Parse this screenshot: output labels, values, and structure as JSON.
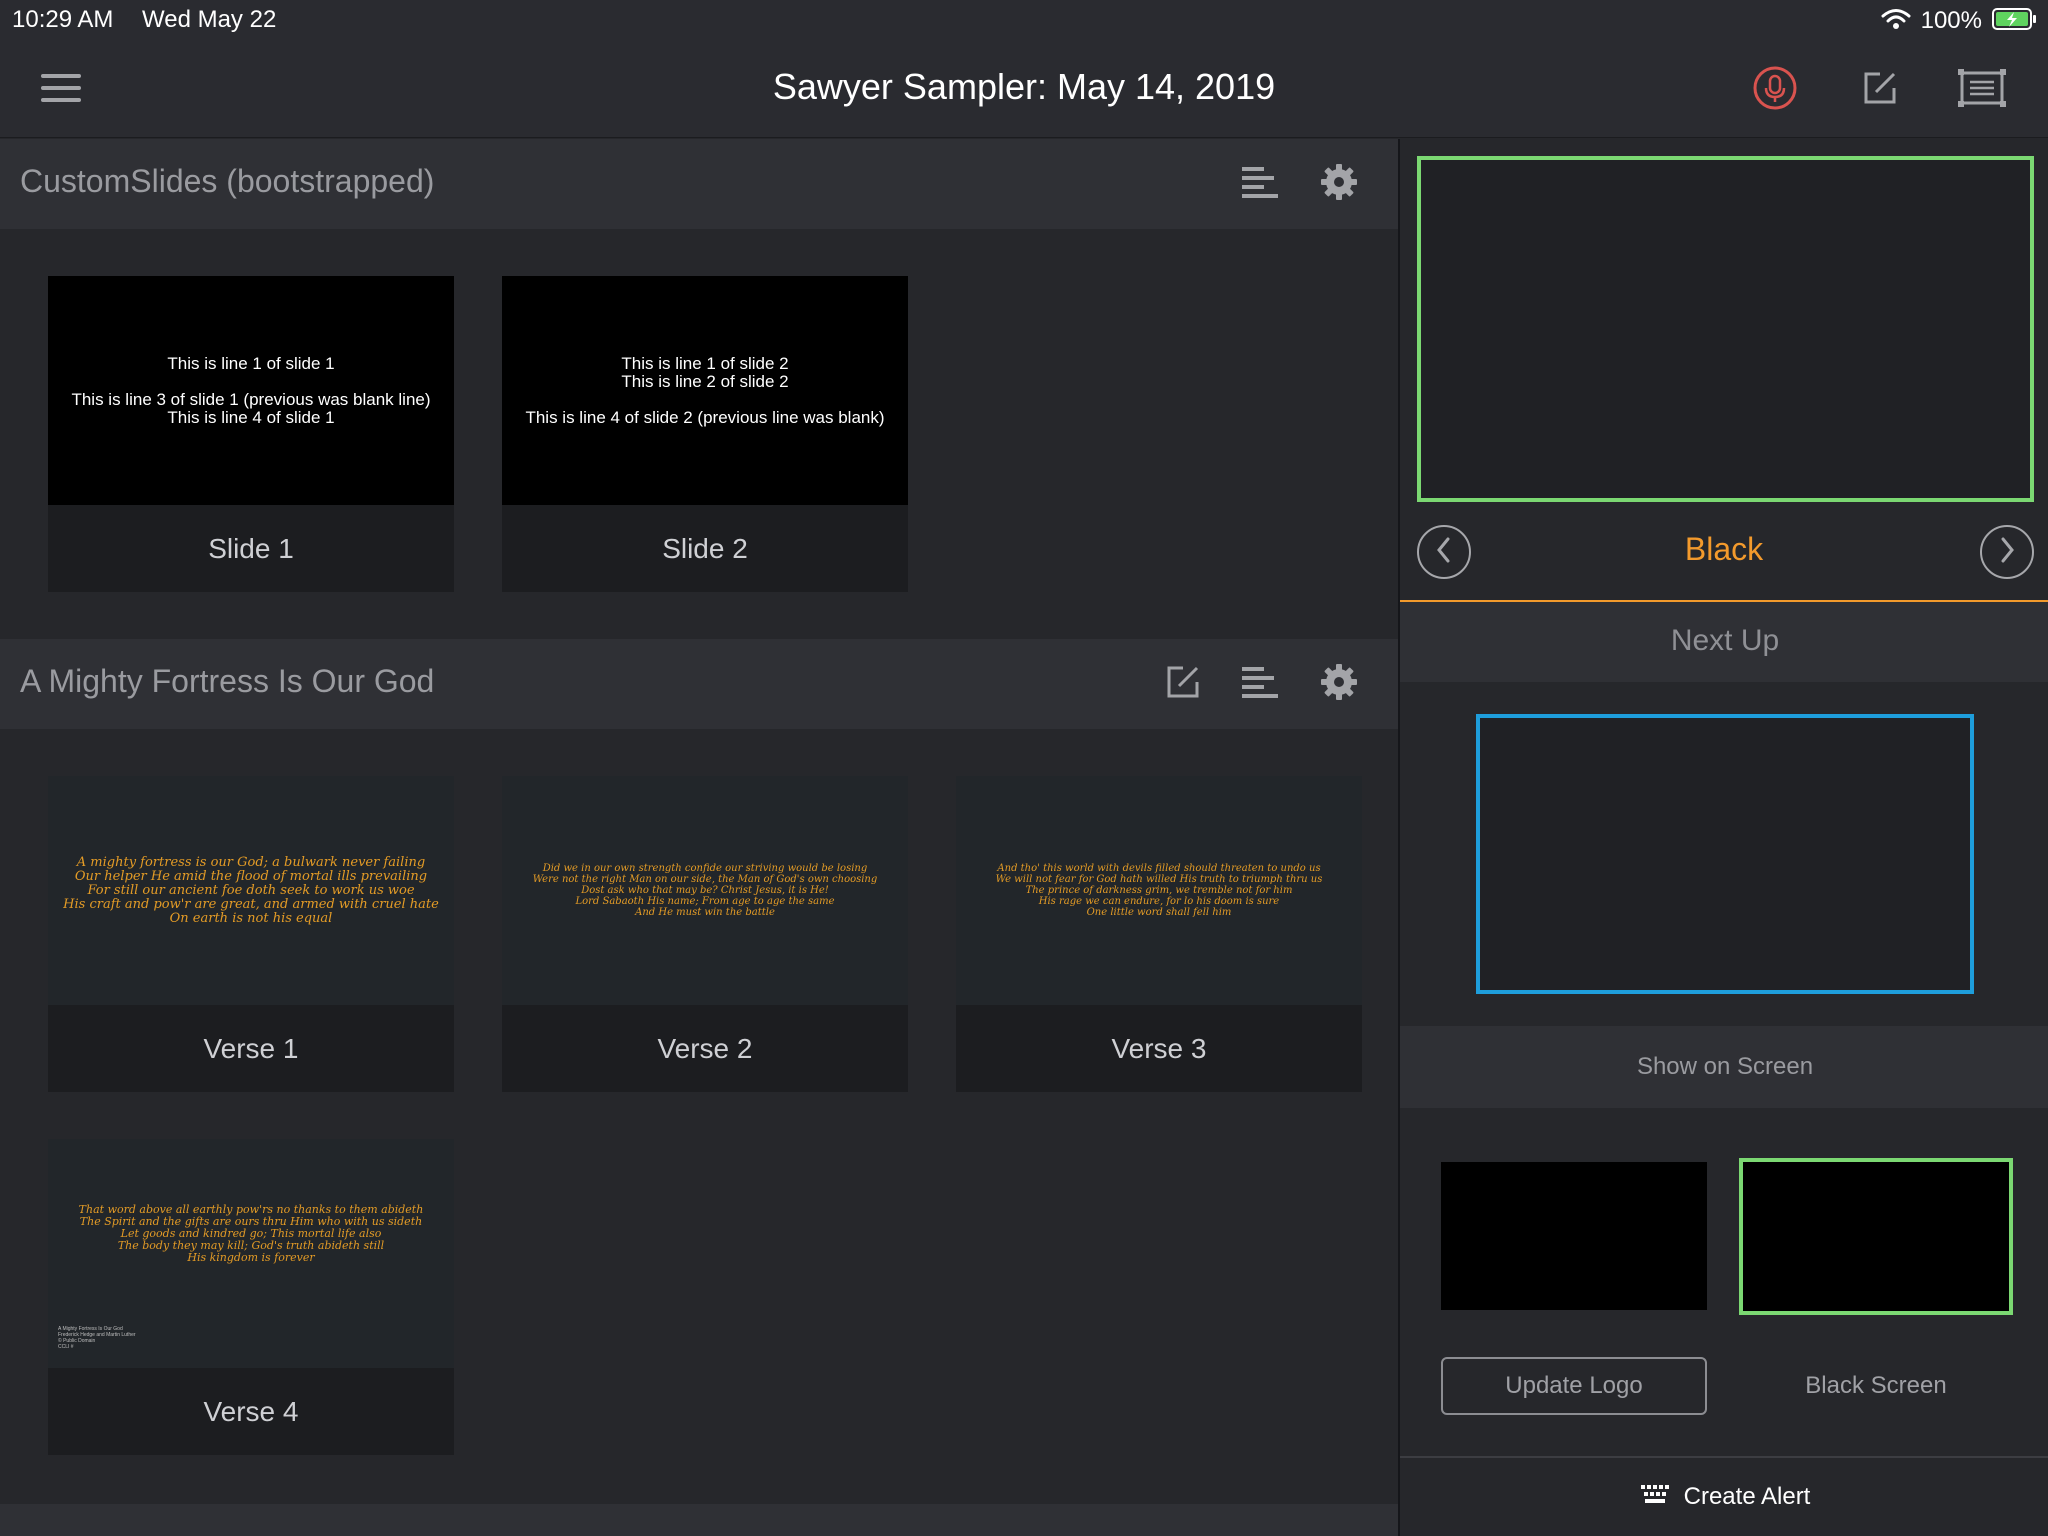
{
  "status_bar": {
    "time": "10:29 AM",
    "date": "Wed May 22",
    "battery": "100%",
    "icons": [
      "wifi-icon",
      "battery-charging-icon"
    ]
  },
  "nav": {
    "title": "Sawyer Sampler: May 14, 2019",
    "icons": [
      "menu-icon",
      "microphone-icon",
      "edit-icon",
      "screen-icon"
    ],
    "mic_color": "#d9534f"
  },
  "sections": [
    {
      "title": "CustomSlides (bootstrapped)",
      "icons": [
        "align-icon",
        "gear-icon"
      ],
      "slides": [
        {
          "label": "Slide 1",
          "text": "This is line 1 of slide 1\n\nThis is line 3 of slide 1 (previous was blank line)\nThis is line 4 of slide 1"
        },
        {
          "label": "Slide 2",
          "text": "This is line 1 of slide 2\nThis is line 2 of slide 2\n\nThis is line 4 of slide 2 (previous line was blank)"
        }
      ]
    },
    {
      "title": "A Mighty Fortress Is Our God",
      "icons": [
        "edit-icon",
        "align-icon",
        "gear-icon"
      ],
      "slides": [
        {
          "label": "Verse 1",
          "text": "A mighty fortress is our God; a bulwark never failing\nOur helper He amid the flood of mortal ills prevailing\nFor still our ancient foe doth seek to work us woe\nHis craft and pow'r are great, and armed with cruel hate\nOn earth is not his equal"
        },
        {
          "label": "Verse 2",
          "text": "Did we in our own strength confide our striving would be losing\nWere not the right Man on our side, the Man of God's own choosing\nDost ask who that may be? Christ Jesus, it is He!\nLord Sabaoth His name; From age to age the same\nAnd He must win the battle"
        },
        {
          "label": "Verse 3",
          "text": "And tho' this world with devils filled should threaten to undo us\nWe will not fear for God hath willed His truth to triumph thru us\nThe prince of darkness grim, we tremble not for him\nHis rage we can endure, for lo his doom is sure\nOne little word shall fell him"
        },
        {
          "label": "Verse 4",
          "text": "That word above all earthly pow'rs no thanks to them abideth\nThe Spirit and the gifts are ours thru Him who with us sideth\nLet goods and kindred go; This mortal life also\nThe body they may kill; God's truth abideth still\nHis kingdom is forever",
          "footnote": "A Mighty Fortress Is Our God\nFrederick Hedge and Martin Luther\n© Public Domain\nCCLI #"
        }
      ]
    }
  ],
  "right_panel": {
    "live_label": "Black",
    "next_up": "Next Up",
    "show_on_screen": "Show on Screen",
    "update_logo": "Update Logo",
    "black_screen": "Black Screen",
    "create_alert": "Create Alert",
    "colors": {
      "live_border": "#7bd872",
      "next_border": "#1e9edc",
      "accent": "#f39a2c"
    }
  }
}
